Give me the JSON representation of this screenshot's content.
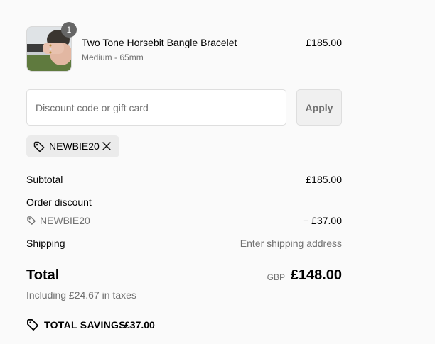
{
  "cart": {
    "item": {
      "name": "Two Tone Horsebit Bangle Bracelet",
      "variant": "Medium - 65mm",
      "price": "£185.00",
      "quantity": "1"
    }
  },
  "discount": {
    "placeholder": "Discount code or gift card",
    "value": "",
    "apply_label": "Apply",
    "applied_code": "NEWBIE20"
  },
  "summary": {
    "subtotal_label": "Subtotal",
    "subtotal_value": "£185.00",
    "order_discount_label": "Order discount",
    "discount_code": "NEWBIE20",
    "discount_value": "− £37.00",
    "shipping_label": "Shipping",
    "shipping_value": "Enter shipping address",
    "total_label": "Total",
    "currency": "GBP",
    "total_value": "£148.00",
    "tax_note": "Including £24.67 in taxes",
    "savings_label": "TOTAL SAVINGS",
    "savings_value": "£37.00"
  },
  "icons": {
    "tag": "tag-icon",
    "close": "close-icon",
    "savings": "savings-tag-icon"
  }
}
